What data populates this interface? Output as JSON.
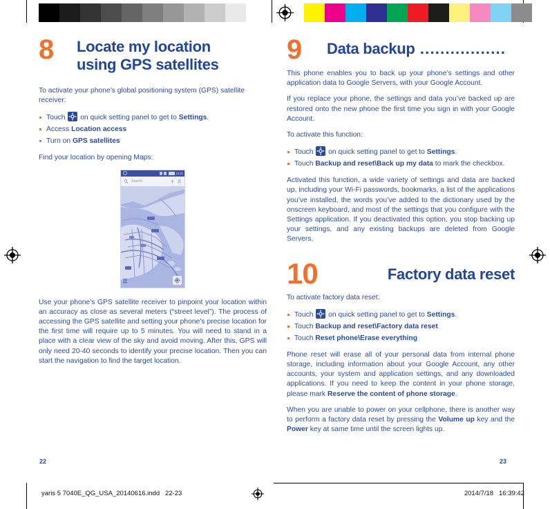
{
  "sheet": {
    "colorbar": {
      "gray_swatches": [
        "#000000",
        "#1c1c1c",
        "#333333",
        "#4d4d4d",
        "#656565",
        "#7e7e7e",
        "#979797",
        "#b2b2b2",
        "#cccccc",
        "#e9e9e9",
        "#ffffff"
      ],
      "color_swatches": [
        "#fff200",
        "#ec008c",
        "#00aeef",
        "#2e3192",
        "#00a651",
        "#ed1c24",
        "#1d1d1b",
        "#fdf07f",
        "#f589c0",
        "#7fd4f5",
        "#8c8c8c"
      ],
      "registration_mark": "registration-target-icon"
    },
    "footer": {
      "file": "yaris 5 7040E_QG_USA_20140616.indd   22-23",
      "timestamp": "2014/7/18   16:39:42"
    }
  },
  "left_page": {
    "page_number": "22",
    "chapter": {
      "number": "8",
      "title_line1": "Locate my location",
      "title_line2_plain": "using ",
      "title_line2_bold": "GPS satellites"
    },
    "intro": "To activate your phone’s global positioning system (GPS) satellite receiver:",
    "bullets": [
      {
        "pre": "Touch ",
        "icon": "settings-gear-icon",
        "mid": " on quick setting panel to get to ",
        "bold": "Settings",
        "post": "."
      },
      {
        "pre": "Access ",
        "bold": "Location access",
        "post": ""
      },
      {
        "pre": "Turn on ",
        "bold": "GPS satellites",
        "post": ""
      }
    ],
    "find_line": "Find your location by opening Maps:",
    "screenshot": {
      "status_time": "21:01",
      "search_placeholder": "Search",
      "search_icon": "magnifier-icon",
      "directions_icon": "directions-icon",
      "account_icon": "person-icon",
      "my_location_icon": "my-location-icon",
      "layers_icon": "layers-icon"
    },
    "closing": "Use your phone’s GPS satellite receiver to pinpoint your location within an accuracy as close as several meters (“street level”). The process of accessing the GPS satellite and setting your phone’s precise location for the first time will require up to 5 minutes. You will need to stand in a place with a clear view of the sky and avoid moving. After this, GPS will only need 20-40 seconds to identify your precise location. Then you can start the navigation to find the target location."
  },
  "right_page": {
    "page_number": "23",
    "chapter9": {
      "number": "9",
      "title": "Data backup",
      "leader": " ................."
    },
    "para1": "This phone enables you to back up your phone’s settings and other application data to Google Servers, with your Google Account.",
    "para2": "If you replace your phone, the settings and data you’ve backed up are restored onto the new phone the first time you sign in with your Google Account.",
    "activate_line": "To activate this function:",
    "bullets": [
      {
        "pre": "Touch ",
        "icon": "settings-gear-icon",
        "mid": " on quick setting panel to get to ",
        "bold": "Settings",
        "post": "."
      },
      {
        "pre": "Touch ",
        "bold": "Backup and reset\\Back up my data",
        "post": " to mark the checkbox."
      }
    ],
    "para3": "Activated this function, a wide variety of settings and data are backed up, including your Wi-Fi passwords, bookmarks, a list of the applications you’ve installed, the words you’ve added to the dictionary used by the onscreen keyboard, and most of the settings that you configure with the Settings application. If you deactivated this option, you stop backing up your settings, and any existing backups are deleted from Google Servers.",
    "chapter10": {
      "number": "10",
      "title": "Factory data reset"
    },
    "activate_line2": "To activate factory data reset:",
    "bullets2": [
      {
        "pre": "Touch ",
        "icon": "settings-gear-icon",
        "mid": " on quick setting panel to get to ",
        "bold": "Settings",
        "post": "."
      },
      {
        "pre": "Touch ",
        "bold": "Backup and reset\\Factory data reset",
        "post": ""
      },
      {
        "pre": "Touch ",
        "bold": "Reset phone\\Erase everything",
        "post": ""
      }
    ],
    "para4_a": "Phone reset will erase all of your personal data from internal phone storage, including information about your Google Account, any other accounts, your system and application settings, and any downloaded applications. If you need to keep the content in your phone storage, please mark ",
    "para4_bold": "Reserve the content of phone storage",
    "para4_b": ".",
    "para5_a": "When you are unable to power on your cellphone, there is another way to perform a factory data reset by pressing the ",
    "para5_bold1": "Volume up",
    "para5_mid": " key and the ",
    "para5_bold2": "Power",
    "para5_b": " key at same time until the screen lights up."
  },
  "colors": {
    "heading_blue": "#22459a",
    "body_blue": "#2a4b9b",
    "accent_orange": "#ee7130"
  }
}
